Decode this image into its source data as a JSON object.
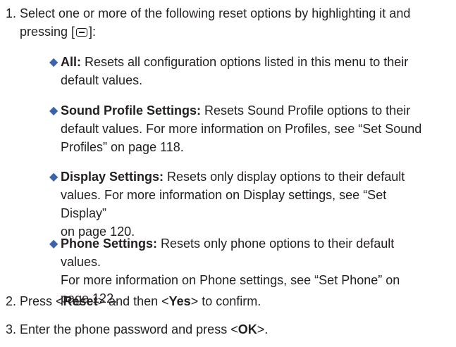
{
  "steps": [
    {
      "number": "1.",
      "line1": "Select one or more of the following reset options by highlighting it and",
      "line2_before": "pressing [",
      "key_icon": "menu-ok-key-icon",
      "line2_after": "]:",
      "options": [
        {
          "name": "All:",
          "lines": [
            "Resets all configuration options listed in this menu to their",
            "default values."
          ]
        },
        {
          "name": "Sound Profile Settings:",
          "lines": [
            "Resets Sound Profile options to their",
            "default values. For more information on Profiles, see “Set Sound",
            "Profiles” on page 118."
          ]
        },
        {
          "name": "Display Settings:",
          "lines": [
            "Resets only display options to their default",
            "values. For more information on Display settings, see “Set Display”",
            "on page 120."
          ]
        },
        {
          "name": "Phone Settings:",
          "lines": [
            "Resets only phone options to their default values.",
            "For more information on Phone settings, see “Set Phone” on",
            "page 122."
          ]
        }
      ]
    },
    {
      "number": "2.",
      "text_before": "Press <",
      "bold1": "Reset",
      "text_middle": "> and then <",
      "bold2": "Yes",
      "text_after": "> to confirm."
    },
    {
      "number": "3.",
      "text_before": "Enter the phone password and press <",
      "bold1": "OK",
      "text_after": ">."
    }
  ],
  "bullet_icon": "diamond-bullet-icon",
  "bullet_color": "#3a63ad"
}
